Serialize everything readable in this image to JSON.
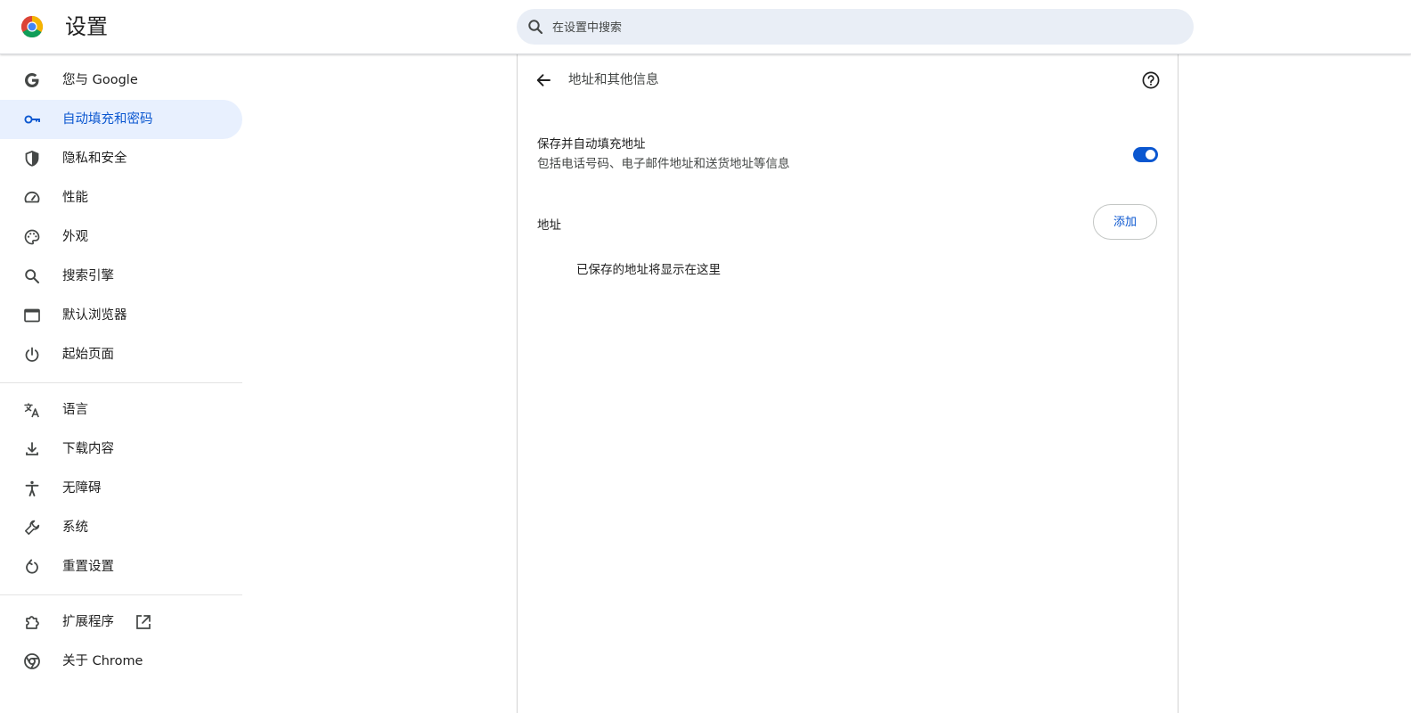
{
  "header": {
    "title": "设置",
    "search": {
      "placeholder": "在设置中搜索"
    }
  },
  "sidebar": {
    "groups": [
      [
        {
          "label": "您与 Google",
          "icon": "google-g-icon"
        },
        {
          "label": "自动填充和密码",
          "icon": "key-icon",
          "active": true
        },
        {
          "label": "隐私和安全",
          "icon": "shield-icon"
        },
        {
          "label": "性能",
          "icon": "speedometer-icon"
        },
        {
          "label": "外观",
          "icon": "palette-icon"
        },
        {
          "label": "搜索引擎",
          "icon": "search-icon"
        },
        {
          "label": "默认浏览器",
          "icon": "browser-window-icon"
        },
        {
          "label": "起始页面",
          "icon": "power-icon"
        }
      ],
      [
        {
          "label": "语言",
          "icon": "translate-icon"
        },
        {
          "label": "下载内容",
          "icon": "download-icon"
        },
        {
          "label": "无障碍",
          "icon": "accessibility-icon"
        },
        {
          "label": "系统",
          "icon": "wrench-icon"
        },
        {
          "label": "重置设置",
          "icon": "reset-icon"
        }
      ],
      [
        {
          "label": "扩展程序",
          "icon": "puzzle-icon",
          "external": true
        },
        {
          "label": "关于 Chrome",
          "icon": "chrome-icon"
        }
      ]
    ]
  },
  "panel": {
    "title": "地址和其他信息",
    "setting": {
      "title": "保存并自动填充地址",
      "subtitle": "包括电话号码、电子邮件地址和送货地址等信息",
      "enabled": true
    },
    "addresses": {
      "label": "地址",
      "add_label": "添加",
      "empty_text": "已保存的地址将显示在这里"
    }
  },
  "colors": {
    "accent": "#0b57d0",
    "active_bg": "#e8f0fe",
    "search_bg": "#e9eef6"
  }
}
